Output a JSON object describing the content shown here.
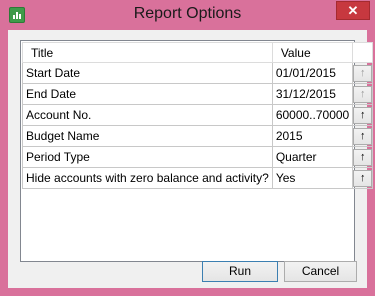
{
  "window": {
    "title": "Report Options",
    "close_label": "✕",
    "frame_color": "#d9719b",
    "icon": "spreadsheet-app-icon"
  },
  "grid": {
    "headers": {
      "title": "Title",
      "value": "Value"
    },
    "rows": [
      {
        "title": "Start Date",
        "value": "01/01/2015",
        "button": "↑",
        "button_enabled": false
      },
      {
        "title": "End Date",
        "value": "31/12/2015",
        "button": "↑",
        "button_enabled": false
      },
      {
        "title": "Account No.",
        "value": "60000..70000",
        "button": "↑",
        "button_enabled": true
      },
      {
        "title": "Budget Name",
        "value": "2015",
        "button": "↑",
        "button_enabled": true
      },
      {
        "title": "Period Type",
        "value": "Quarter",
        "button": "↑",
        "button_enabled": true
      },
      {
        "title": "Hide accounts with zero balance and activity?",
        "value": "Yes",
        "button": "↑",
        "button_enabled": true
      }
    ]
  },
  "buttons": {
    "run": "Run",
    "cancel": "Cancel"
  }
}
